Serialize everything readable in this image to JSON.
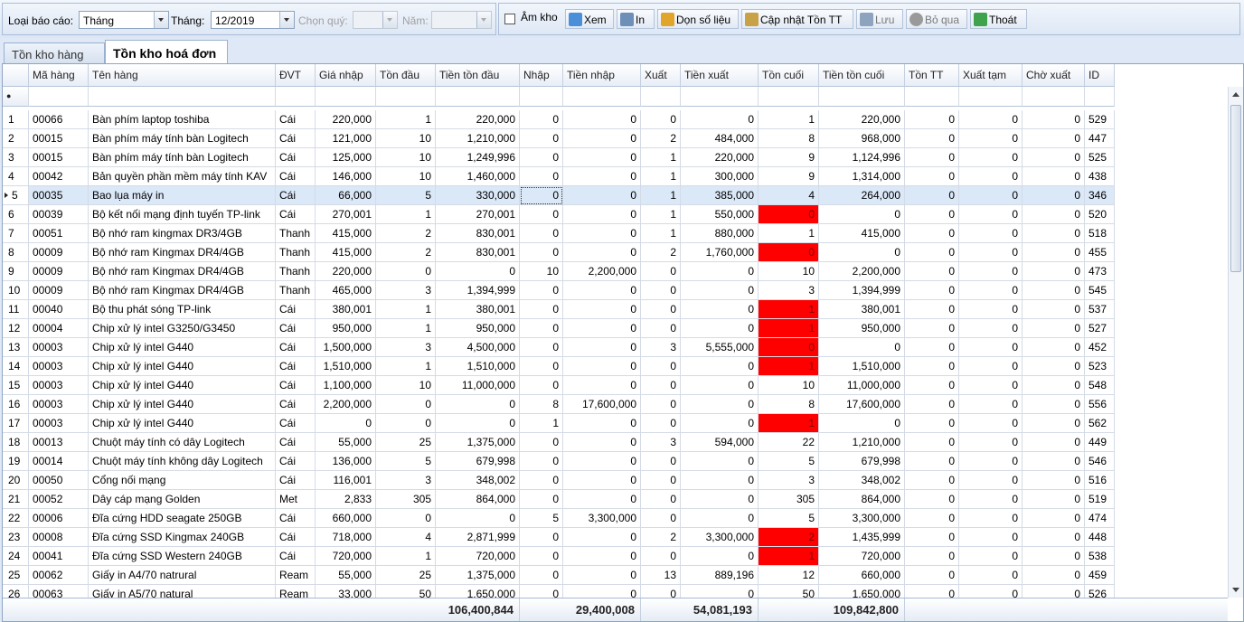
{
  "toolbar": {
    "report_type_label": "Loại báo cáo:",
    "report_type_value": "Tháng",
    "month_label": "Tháng:",
    "month_value": "12/2019",
    "quarter_label": "Chọn quý:",
    "quarter_value": "",
    "year_label": "Năm:",
    "year_value": "",
    "negative_stock_label": "Âm kho",
    "buttons": {
      "view": "Xem",
      "print": "In",
      "clean": "Dọn số liệu",
      "update_stock": "Cập nhật Tồn TT",
      "save": "Lưu",
      "skip": "Bỏ qua",
      "exit": "Thoát"
    },
    "button_colors": {
      "view": "#4a8fd8",
      "print": "#6d8fb8",
      "clean": "#e1a52c",
      "update_stock": "#c9a245",
      "save": "#8ea3bd",
      "skip": "#9a9a9a",
      "exit": "#3fa34d"
    },
    "button_icons": {
      "view": "magnifier-icon",
      "print": "printer-icon",
      "clean": "database-icon",
      "update_stock": "tools-icon",
      "save": "floppy-icon",
      "skip": "cancel-icon",
      "exit": "exit-icon"
    }
  },
  "tabs": [
    "Tồn kho hàng",
    "Tồn kho hoá đơn"
  ],
  "active_tab": 1,
  "grid": {
    "columns": [
      "",
      "Mã hàng",
      "Tên hàng",
      "ĐVT",
      "Giá nhập",
      "Tồn đầu",
      "Tiền tồn đầu",
      "Nhập",
      "Tiền nhập",
      "Xuất",
      "Tiền xuất",
      "Tồn cuối",
      "Tiền tồn cuối",
      "Tồn TT",
      "Xuất tạm",
      "Chờ xuất",
      "ID"
    ],
    "selected_row": 4,
    "highlight_color": "#ff0000",
    "rows": [
      [
        "1",
        "00066",
        "Bàn phím laptop toshiba",
        "Cái",
        "220,000",
        "1",
        "220,000",
        "0",
        "0",
        "0",
        "0",
        "1",
        "220,000",
        "0",
        "0",
        "0",
        "529"
      ],
      [
        "2",
        "00015",
        "Bàn phím máy tính bàn Logitech",
        "Cái",
        "121,000",
        "10",
        "1,210,000",
        "0",
        "0",
        "2",
        "484,000",
        "8",
        "968,000",
        "0",
        "0",
        "0",
        "447"
      ],
      [
        "3",
        "00015",
        "Bàn phím máy tính bàn Logitech",
        "Cái",
        "125,000",
        "10",
        "1,249,996",
        "0",
        "0",
        "1",
        "220,000",
        "9",
        "1,124,996",
        "0",
        "0",
        "0",
        "525"
      ],
      [
        "4",
        "00042",
        "Bản quyền phần mềm máy tính KAV",
        "Cái",
        "146,000",
        "10",
        "1,460,000",
        "0",
        "0",
        "1",
        "300,000",
        "9",
        "1,314,000",
        "0",
        "0",
        "0",
        "438"
      ],
      [
        "5",
        "00035",
        "Bao lụa máy in",
        "Cái",
        "66,000",
        "5",
        "330,000",
        "0",
        "0",
        "1",
        "385,000",
        "4",
        "264,000",
        "0",
        "0",
        "0",
        "346"
      ],
      [
        "6",
        "00039",
        "Bộ kết nối mạng định tuyến TP-link",
        "Cái",
        "270,001",
        "1",
        "270,001",
        "0",
        "0",
        "1",
        "550,000",
        "0",
        "0",
        "0",
        "0",
        "0",
        "520"
      ],
      [
        "7",
        "00051",
        "Bộ nhớ ram kingmax DR3/4GB",
        "Thanh",
        "415,000",
        "2",
        "830,001",
        "0",
        "0",
        "1",
        "880,000",
        "1",
        "415,000",
        "0",
        "0",
        "0",
        "518"
      ],
      [
        "8",
        "00009",
        "Bộ nhớ ram Kingmax DR4/4GB",
        "Thanh",
        "415,000",
        "2",
        "830,001",
        "0",
        "0",
        "2",
        "1,760,000",
        "0",
        "0",
        "0",
        "0",
        "0",
        "455"
      ],
      [
        "9",
        "00009",
        "Bộ nhớ ram Kingmax DR4/4GB",
        "Thanh",
        "220,000",
        "0",
        "0",
        "10",
        "2,200,000",
        "0",
        "0",
        "10",
        "2,200,000",
        "0",
        "0",
        "0",
        "473"
      ],
      [
        "10",
        "00009",
        "Bộ nhớ ram Kingmax DR4/4GB",
        "Thanh",
        "465,000",
        "3",
        "1,394,999",
        "0",
        "0",
        "0",
        "0",
        "3",
        "1,394,999",
        "0",
        "0",
        "0",
        "545"
      ],
      [
        "11",
        "00040",
        "Bộ thu phát sóng TP-link",
        "Cái",
        "380,001",
        "1",
        "380,001",
        "0",
        "0",
        "0",
        "0",
        "1",
        "380,001",
        "0",
        "0",
        "0",
        "537"
      ],
      [
        "12",
        "00004",
        "Chip xử lý intel G3250/G3450",
        "Cái",
        "950,000",
        "1",
        "950,000",
        "0",
        "0",
        "0",
        "0",
        "1",
        "950,000",
        "0",
        "0",
        "0",
        "527"
      ],
      [
        "13",
        "00003",
        "Chip xử lý intel G440",
        "Cái",
        "1,500,000",
        "3",
        "4,500,000",
        "0",
        "0",
        "3",
        "5,555,000",
        "0",
        "0",
        "0",
        "0",
        "0",
        "452"
      ],
      [
        "14",
        "00003",
        "Chip xử lý intel G440",
        "Cái",
        "1,510,000",
        "1",
        "1,510,000",
        "0",
        "0",
        "0",
        "0",
        "1",
        "1,510,000",
        "0",
        "0",
        "0",
        "523"
      ],
      [
        "15",
        "00003",
        "Chip xử lý intel G440",
        "Cái",
        "1,100,000",
        "10",
        "11,000,000",
        "0",
        "0",
        "0",
        "0",
        "10",
        "11,000,000",
        "0",
        "0",
        "0",
        "548"
      ],
      [
        "16",
        "00003",
        "Chip xử lý intel G440",
        "Cái",
        "2,200,000",
        "0",
        "0",
        "8",
        "17,600,000",
        "0",
        "0",
        "8",
        "17,600,000",
        "0",
        "0",
        "0",
        "556"
      ],
      [
        "17",
        "00003",
        "Chip xử lý intel G440",
        "Cái",
        "0",
        "0",
        "0",
        "1",
        "0",
        "0",
        "0",
        "1",
        "0",
        "0",
        "0",
        "0",
        "562"
      ],
      [
        "18",
        "00013",
        "Chuột máy tính có dây Logitech",
        "Cái",
        "55,000",
        "25",
        "1,375,000",
        "0",
        "0",
        "3",
        "594,000",
        "22",
        "1,210,000",
        "0",
        "0",
        "0",
        "449"
      ],
      [
        "19",
        "00014",
        "Chuột máy tính không dây Logitech",
        "Cái",
        "136,000",
        "5",
        "679,998",
        "0",
        "0",
        "0",
        "0",
        "5",
        "679,998",
        "0",
        "0",
        "0",
        "546"
      ],
      [
        "20",
        "00050",
        "Cổng nối mạng",
        "Cái",
        "116,001",
        "3",
        "348,002",
        "0",
        "0",
        "0",
        "0",
        "3",
        "348,002",
        "0",
        "0",
        "0",
        "516"
      ],
      [
        "21",
        "00052",
        "Dây cáp mạng Golden",
        "Met",
        "2,833",
        "305",
        "864,000",
        "0",
        "0",
        "0",
        "0",
        "305",
        "864,000",
        "0",
        "0",
        "0",
        "519"
      ],
      [
        "22",
        "00006",
        "Đĩa cứng HDD seagate 250GB",
        "Cái",
        "660,000",
        "0",
        "0",
        "5",
        "3,300,000",
        "0",
        "0",
        "5",
        "3,300,000",
        "0",
        "0",
        "0",
        "474"
      ],
      [
        "23",
        "00008",
        "Đĩa cứng SSD Kingmax 240GB",
        "Cái",
        "718,000",
        "4",
        "2,871,999",
        "0",
        "0",
        "2",
        "3,300,000",
        "2",
        "1,435,999",
        "0",
        "0",
        "0",
        "448"
      ],
      [
        "24",
        "00041",
        "Đĩa cứng SSD Western 240GB",
        "Cái",
        "720,000",
        "1",
        "720,000",
        "0",
        "0",
        "0",
        "0",
        "1",
        "720,000",
        "0",
        "0",
        "0",
        "538"
      ],
      [
        "25",
        "00062",
        "Giấy in A4/70 natrural",
        "Ream",
        "55,000",
        "25",
        "1,375,000",
        "0",
        "0",
        "13",
        "889,196",
        "12",
        "660,000",
        "0",
        "0",
        "0",
        "459"
      ],
      [
        "26",
        "00063",
        "Giấy in A5/70 natural",
        "Ream",
        "33,000",
        "50",
        "1,650,000",
        "0",
        "0",
        "0",
        "0",
        "50",
        "1,650,000",
        "0",
        "0",
        "0",
        "526"
      ]
    ],
    "red_cells": [
      [
        5,
        11
      ],
      [
        7,
        11
      ],
      [
        10,
        11
      ],
      [
        11,
        11
      ],
      [
        12,
        11
      ],
      [
        13,
        11
      ],
      [
        16,
        11
      ],
      [
        22,
        11
      ],
      [
        23,
        11
      ]
    ],
    "totals": {
      "tien_ton_dau": "106,400,844",
      "tien_nhap": "29,400,008",
      "tien_xuat": "54,081,193",
      "tien_ton_cuoi": "109,842,800"
    }
  }
}
